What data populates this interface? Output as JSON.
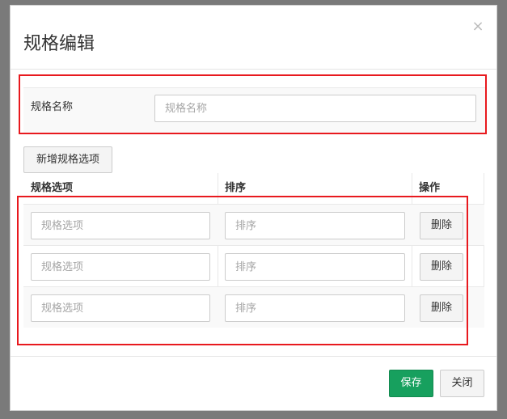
{
  "dialog": {
    "title": "规格编辑",
    "close_symbol": "×"
  },
  "spec_name": {
    "label": "规格名称",
    "value": "",
    "placeholder": "规格名称"
  },
  "add_option_button": "新增规格选项",
  "table": {
    "headers": [
      "规格选项",
      "排序",
      "操作"
    ],
    "rows": [
      {
        "option_value": "",
        "option_placeholder": "规格选项",
        "sort_value": "",
        "sort_placeholder": "排序",
        "delete_label": "删除"
      },
      {
        "option_value": "",
        "option_placeholder": "规格选项",
        "sort_value": "",
        "sort_placeholder": "排序",
        "delete_label": "删除"
      },
      {
        "option_value": "",
        "option_placeholder": "规格选项",
        "sort_value": "",
        "sort_placeholder": "排序",
        "delete_label": "删除"
      }
    ]
  },
  "footer": {
    "save_label": "保存",
    "close_label": "关闭"
  },
  "colors": {
    "primary": "#17a05e",
    "highlight": "#e8191e"
  }
}
